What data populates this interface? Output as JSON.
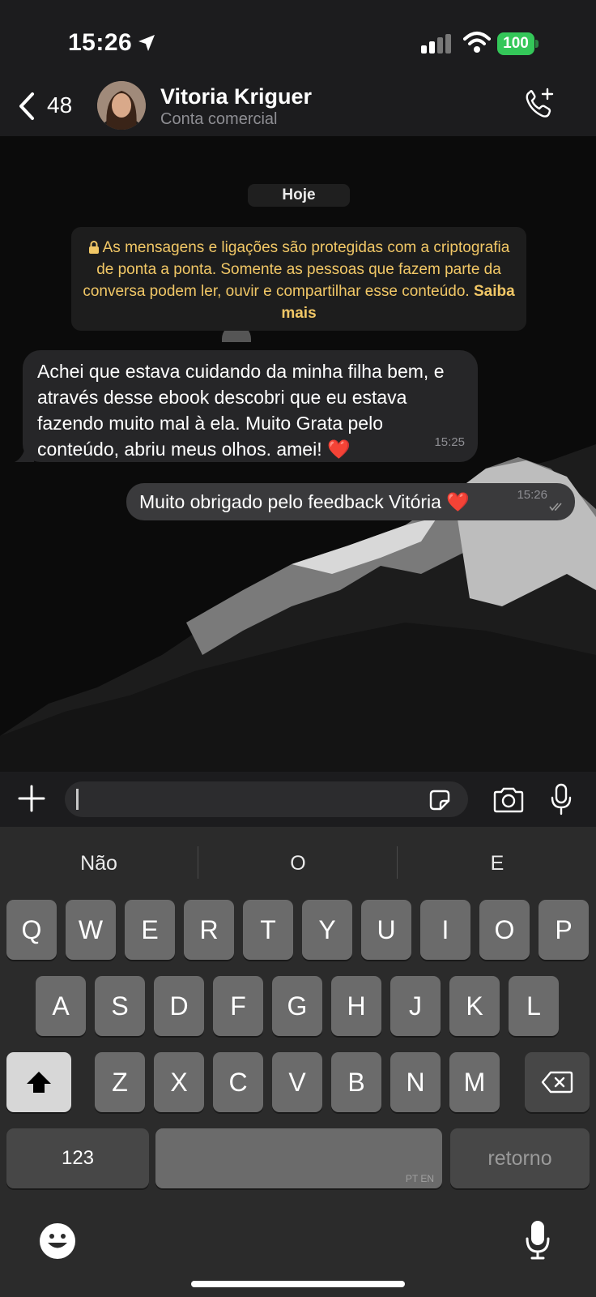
{
  "status_bar": {
    "time": "15:26",
    "battery": "100"
  },
  "header": {
    "back_count": "48",
    "contact_name": "Vitoria Kriguer",
    "contact_subtitle": "Conta comercial"
  },
  "chat": {
    "date_label": "Hoje",
    "security_notice": {
      "text": "As mensagens e ligações são protegidas com a criptografia de ponta a ponta. Somente as pessoas que fazem parte da conversa podem ler, ouvir e compartilhar esse conteúdo. ",
      "link": "Saiba mais"
    },
    "messages": [
      {
        "direction": "in",
        "text": "Achei que estava cuidando da minha filha bem, e através desse ebook descobri que eu estava fazendo muito mal à ela. Muito Grata pelo conteúdo, abriu meus olhos. amei! ❤️",
        "time": "15:25"
      },
      {
        "direction": "out",
        "text": "Muito obrigado pelo feedback Vitória ❤️",
        "time": "15:26"
      }
    ]
  },
  "input": {
    "value": "",
    "placeholder": ""
  },
  "keyboard": {
    "suggestions": [
      "Não",
      "O",
      "E"
    ],
    "row1": [
      "Q",
      "W",
      "E",
      "R",
      "T",
      "Y",
      "U",
      "I",
      "O",
      "P"
    ],
    "row2": [
      "A",
      "S",
      "D",
      "F",
      "G",
      "H",
      "J",
      "K",
      "L"
    ],
    "row3": [
      "Z",
      "X",
      "C",
      "V",
      "B",
      "N",
      "M"
    ],
    "numbers_key": "123",
    "space_lang": "PT EN",
    "return_key": "retorno"
  },
  "colors": {
    "battery": "#34c759",
    "security_text": "#f1c766",
    "incoming_bubble": "#262628",
    "outgoing_bubble": "#3a3a3c"
  }
}
